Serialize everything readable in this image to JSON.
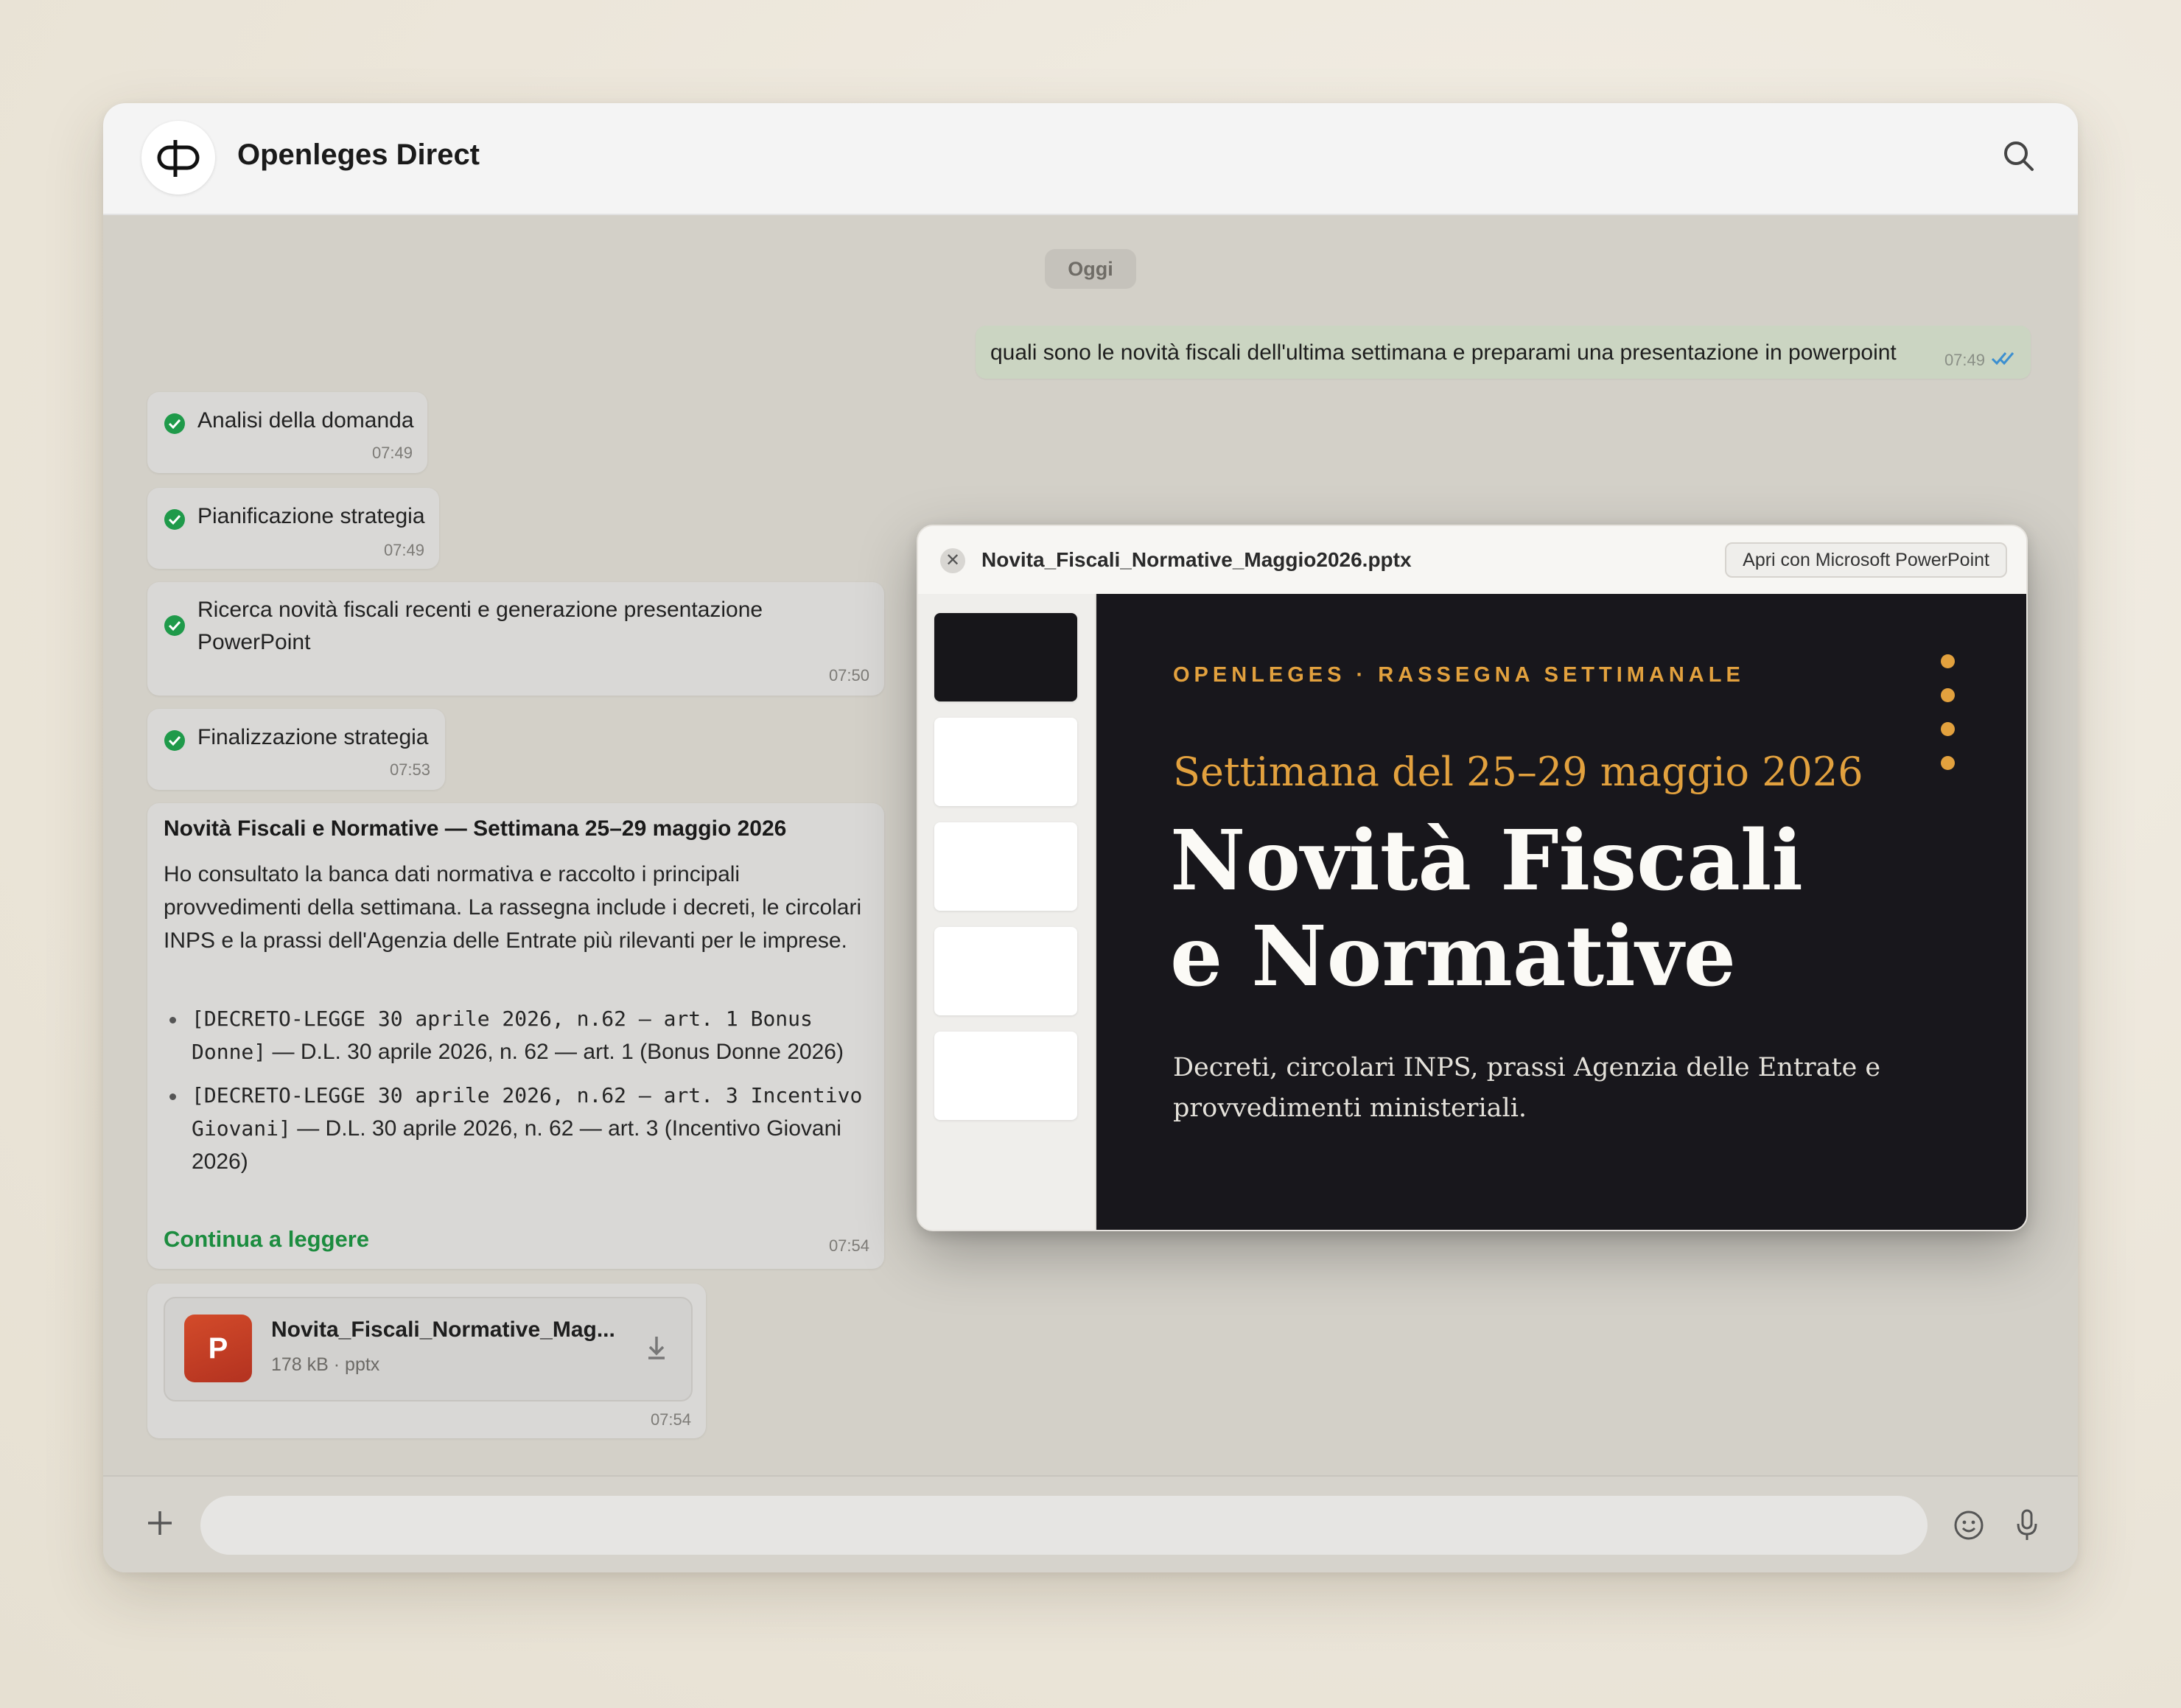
{
  "app": {
    "title": "Openleges Direct"
  },
  "chat": {
    "date_chip": "Oggi",
    "outgoing": {
      "text": "quali sono le novità fiscali dell'ultima settimana e preparami una presentazione in powerpoint",
      "time": "07:49"
    },
    "steps": [
      {
        "label": "Analisi della domanda",
        "time": "07:49"
      },
      {
        "label": "Pianificazione strategia",
        "time": "07:49"
      },
      {
        "label": "Ricerca novità fiscali recenti e generazione presentazione PowerPoint",
        "time": "07:50"
      },
      {
        "label": "Finalizzazione strategia",
        "time": "07:53"
      }
    ],
    "answer": {
      "title": "Novità Fiscali e Normative — Settimana 25–29 maggio 2026",
      "paragraph": "Ho consultato la banca dati normativa e raccolto i principali provvedimenti della settimana. La rassegna include i decreti, le circolari INPS e la prassi dell'Agenzia delle Entrate più rilevanti per le imprese.",
      "bullets": [
        {
          "code": "[DECRETO-LEGGE 30 aprile 2026, n.62 — art. 1 Bonus Donne]",
          "text": " — D.L. 30 aprile 2026, n. 62 — art. 1 (Bonus Donne 2026)"
        },
        {
          "code": "[DECRETO-LEGGE 30 aprile 2026, n.62 — art. 3 Incentivo Giovani]",
          "text": " — D.L. 30 aprile 2026, n. 62 — art. 3 (Incentivo Giovani 2026)"
        }
      ],
      "read_more": "Continua a leggere",
      "time": "07:54"
    },
    "file": {
      "icon_letter": "P",
      "name": "Novita_Fiscali_Normative_Mag...",
      "meta": "178 kB · pptx",
      "time": "07:54"
    }
  },
  "preview": {
    "close_glyph": "✕",
    "filename": "Novita_Fiscali_Normative_Maggio2026.pptx",
    "open_button": "Apri con Microsoft PowerPoint",
    "slide": {
      "kicker": "OPENLEGES · RASSEGNA SETTIMANALE",
      "subtitle": "Settimana del 25–29 maggio 2026",
      "title_line1": "Novità Fiscali",
      "title_line2": "e Normative",
      "description": "Decreti, circolari INPS, prassi Agenzia delle Entrate e provvedimenti ministeriali."
    }
  },
  "icons": {
    "logo": "openleges-logo-icon",
    "search": "search-icon",
    "check": "check-circle-icon",
    "read_receipt": "double-check-icon",
    "powerpoint": "powerpoint-file-icon",
    "download": "download-icon",
    "plus": "plus-icon",
    "emoji": "emoji-icon",
    "mic": "microphone-icon"
  },
  "colors": {
    "accent_green": "#1c8c3f",
    "outgoing_bubble": "#cbd5c2",
    "slide_bg": "#18171c",
    "slide_accent": "#e2a13e",
    "powerpoint_red": "#c43d24"
  }
}
